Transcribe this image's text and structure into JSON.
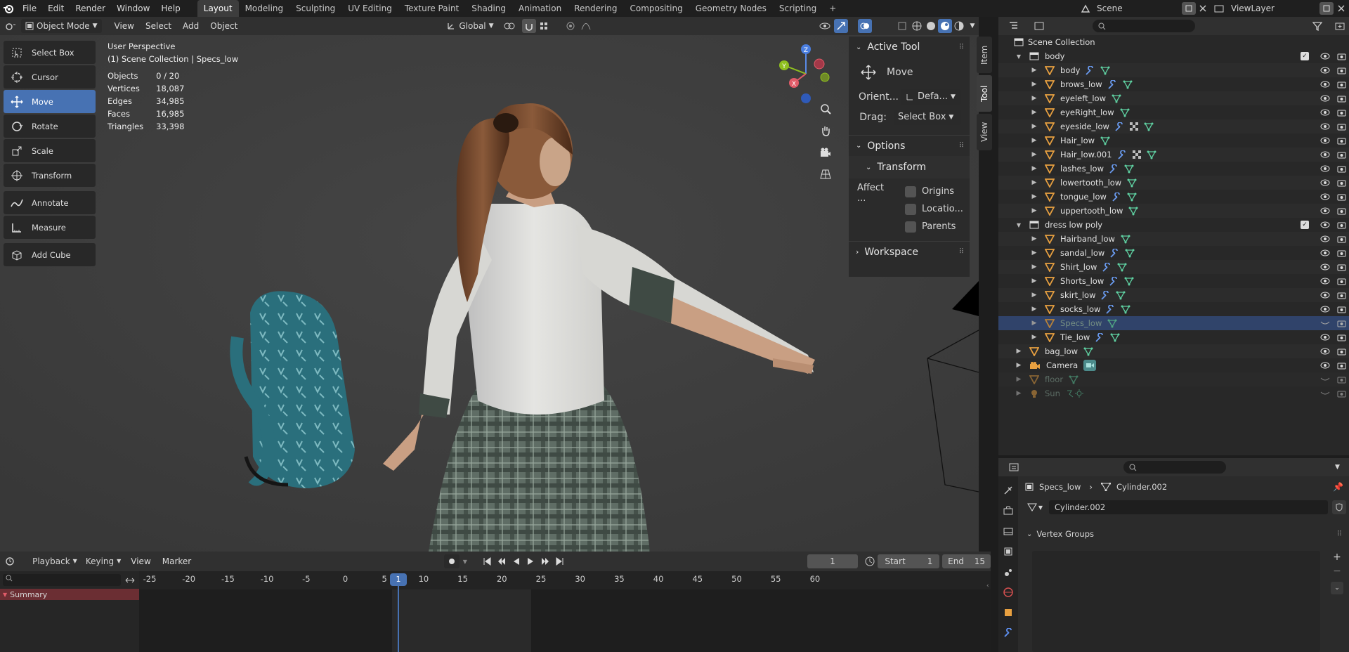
{
  "topbar": {
    "menus": [
      "File",
      "Edit",
      "Render",
      "Window",
      "Help"
    ],
    "workspaces": [
      "Layout",
      "Modeling",
      "Sculpting",
      "UV Editing",
      "Texture Paint",
      "Shading",
      "Animation",
      "Rendering",
      "Compositing",
      "Geometry Nodes",
      "Scripting"
    ],
    "active_workspace": "Layout",
    "add_workspace": "+",
    "scene": "Scene",
    "view_layer": "ViewLayer"
  },
  "viewport_header": {
    "mode": "Object Mode",
    "menus": [
      "View",
      "Select",
      "Add",
      "Object"
    ],
    "orientation": "Global"
  },
  "toolbar": [
    {
      "label": "Select Box",
      "icon": "select-box-icon"
    },
    {
      "label": "Cursor",
      "icon": "cursor-icon"
    },
    {
      "label": "Move",
      "icon": "move-icon",
      "active": true
    },
    {
      "label": "Rotate",
      "icon": "rotate-icon"
    },
    {
      "label": "Scale",
      "icon": "scale-icon"
    },
    {
      "label": "Transform",
      "icon": "transform-icon"
    },
    {
      "label": "Annotate",
      "icon": "annotate-icon"
    },
    {
      "label": "Measure",
      "icon": "measure-icon"
    },
    {
      "label": "Add Cube",
      "icon": "add-cube-icon"
    }
  ],
  "overlay": {
    "view_name": "User Perspective",
    "context": "(1) Scene Collection | Specs_low",
    "stats": [
      {
        "label": "Objects",
        "value": "0 / 20"
      },
      {
        "label": "Vertices",
        "value": "18,087"
      },
      {
        "label": "Edges",
        "value": "34,985"
      },
      {
        "label": "Faces",
        "value": "16,985"
      },
      {
        "label": "Triangles",
        "value": "33,398"
      }
    ]
  },
  "gizmo": {
    "x": "X",
    "y": "Y",
    "z": "Z"
  },
  "npanel": {
    "tabs": [
      "Item",
      "Tool",
      "View"
    ],
    "active_tool_header": "Active Tool",
    "tool_name": "Move",
    "orient_label": "Orient...",
    "orient_value": "Defa...",
    "drag_label": "Drag:",
    "drag_value": "Select Box",
    "options_header": "Options",
    "transform_header": "Transform",
    "affect_label": "Affect ...",
    "affect_options": [
      "Origins",
      "Locatio...",
      "Parents"
    ],
    "workspace_header": "Workspace"
  },
  "outliner": {
    "root": "Scene Collection",
    "rows": [
      {
        "name": "body",
        "level": 1,
        "type": "collection",
        "expanded": true
      },
      {
        "name": "body",
        "level": 2,
        "mods": [
          "wrench",
          "mesh"
        ]
      },
      {
        "name": "brows_low",
        "level": 2,
        "mods": [
          "wrench",
          "mesh"
        ]
      },
      {
        "name": "eyeleft_low",
        "level": 2,
        "mods": [
          "mesh"
        ]
      },
      {
        "name": "eyeRight_low",
        "level": 2,
        "mods": [
          "mesh"
        ]
      },
      {
        "name": "eyeside_low",
        "level": 2,
        "mods": [
          "wrench",
          "checker",
          "mesh"
        ]
      },
      {
        "name": "Hair_low",
        "level": 2,
        "mods": [
          "mesh"
        ]
      },
      {
        "name": "Hair_low.001",
        "level": 2,
        "mods": [
          "wrench",
          "checker",
          "mesh"
        ]
      },
      {
        "name": "lashes_low",
        "level": 2,
        "mods": [
          "wrench",
          "mesh"
        ]
      },
      {
        "name": "lowertooth_low",
        "level": 2,
        "mods": [
          "mesh"
        ]
      },
      {
        "name": "tongue_low",
        "level": 2,
        "mods": [
          "wrench",
          "mesh"
        ]
      },
      {
        "name": "uppertooth_low",
        "level": 2,
        "mods": [
          "mesh"
        ]
      },
      {
        "name": "dress low poly",
        "level": 1,
        "type": "collection",
        "expanded": true
      },
      {
        "name": "Hairband_low",
        "level": 2,
        "mods": [
          "mesh"
        ]
      },
      {
        "name": "sandal_low",
        "level": 2,
        "mods": [
          "wrench",
          "mesh"
        ]
      },
      {
        "name": "Shirt_low",
        "level": 2,
        "mods": [
          "wrench",
          "mesh"
        ]
      },
      {
        "name": "Shorts_low",
        "level": 2,
        "mods": [
          "wrench",
          "mesh"
        ]
      },
      {
        "name": "skirt_low",
        "level": 2,
        "mods": [
          "wrench",
          "mesh"
        ]
      },
      {
        "name": "socks_low",
        "level": 2,
        "mods": [
          "wrench",
          "mesh"
        ]
      },
      {
        "name": "Specs_low",
        "level": 2,
        "mods": [
          "mesh"
        ],
        "selected": true,
        "hidden": true
      },
      {
        "name": "Tie_low",
        "level": 2,
        "mods": [
          "wrench",
          "mesh"
        ]
      },
      {
        "name": "bag_low",
        "level": 1,
        "mods": [
          "mesh"
        ]
      },
      {
        "name": "Camera",
        "level": 1,
        "type": "camera",
        "mods": [
          "camera-data"
        ]
      },
      {
        "name": "floor",
        "level": 1,
        "mods": [
          "mesh"
        ],
        "hidden": true
      },
      {
        "name": "Sun",
        "level": 1,
        "type": "light",
        "mods": [
          "light-data"
        ],
        "hidden": true
      }
    ]
  },
  "properties": {
    "breadcrumb_object": "Specs_low",
    "breadcrumb_data": "Cylinder.002",
    "data_name": "Cylinder.002",
    "section": "Vertex Groups"
  },
  "timeline": {
    "menus": [
      "Playback",
      "Keying",
      "View",
      "Marker"
    ],
    "current_frame": "1",
    "start_label": "Start",
    "start": "1",
    "end_label": "End",
    "end": "15",
    "ticks": [
      "-25",
      "-20",
      "-15",
      "-10",
      "-5",
      "0",
      "5",
      "10",
      "15",
      "20",
      "25",
      "30",
      "35",
      "40",
      "45",
      "50",
      "55",
      "60"
    ],
    "playhead_label": "1",
    "summary": "Summary"
  },
  "colors": {
    "accent": "#4772b3",
    "selected_row": "#334d80",
    "mesh_icon": "#5fd1a2",
    "object_icon": "#e8a040"
  }
}
